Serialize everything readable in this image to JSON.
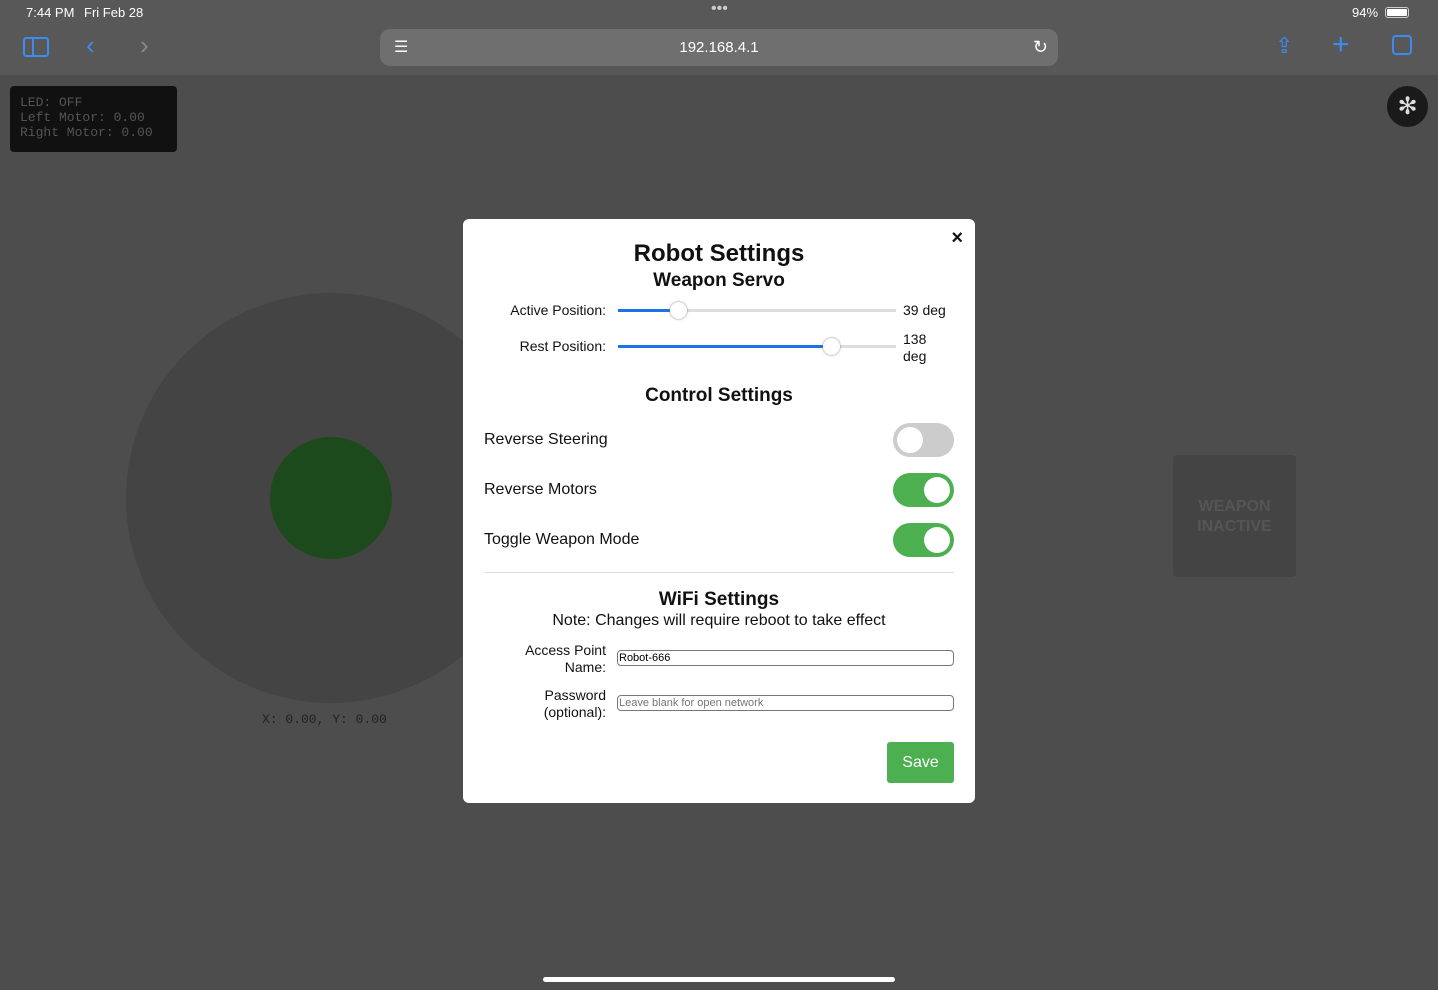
{
  "status": {
    "time": "7:44 PM",
    "date": "Fri Feb 28",
    "battery": "94%"
  },
  "browser": {
    "url": "192.168.4.1"
  },
  "telemetry": {
    "led": "LED: OFF",
    "left": "Left Motor: 0.00",
    "right": "Right Motor: 0.00"
  },
  "joystick": {
    "coords": "X: 0.00, Y: 0.00"
  },
  "weapon": {
    "label": "WEAPON INACTIVE"
  },
  "modal": {
    "title": "Robot Settings",
    "close": "×",
    "servo": {
      "heading": "Weapon Servo",
      "range": [
        0,
        180
      ],
      "active": {
        "label": "Active Position:",
        "value": 39,
        "text": "39 deg"
      },
      "rest": {
        "label": "Rest Position:",
        "value": 138,
        "text": "138 deg"
      }
    },
    "control": {
      "heading": "Control Settings",
      "toggles": [
        {
          "label": "Reverse Steering",
          "on": false
        },
        {
          "label": "Reverse Motors",
          "on": true
        },
        {
          "label": "Toggle Weapon Mode",
          "on": true
        }
      ]
    },
    "wifi": {
      "heading": "WiFi Settings",
      "note": "Note: Changes will require reboot to take effect",
      "ap_label": "Access Point Name:",
      "ap_value": "Robot-666",
      "pw_label": "Password (optional):",
      "pw_placeholder": "Leave blank for open network"
    },
    "save": "Save"
  }
}
